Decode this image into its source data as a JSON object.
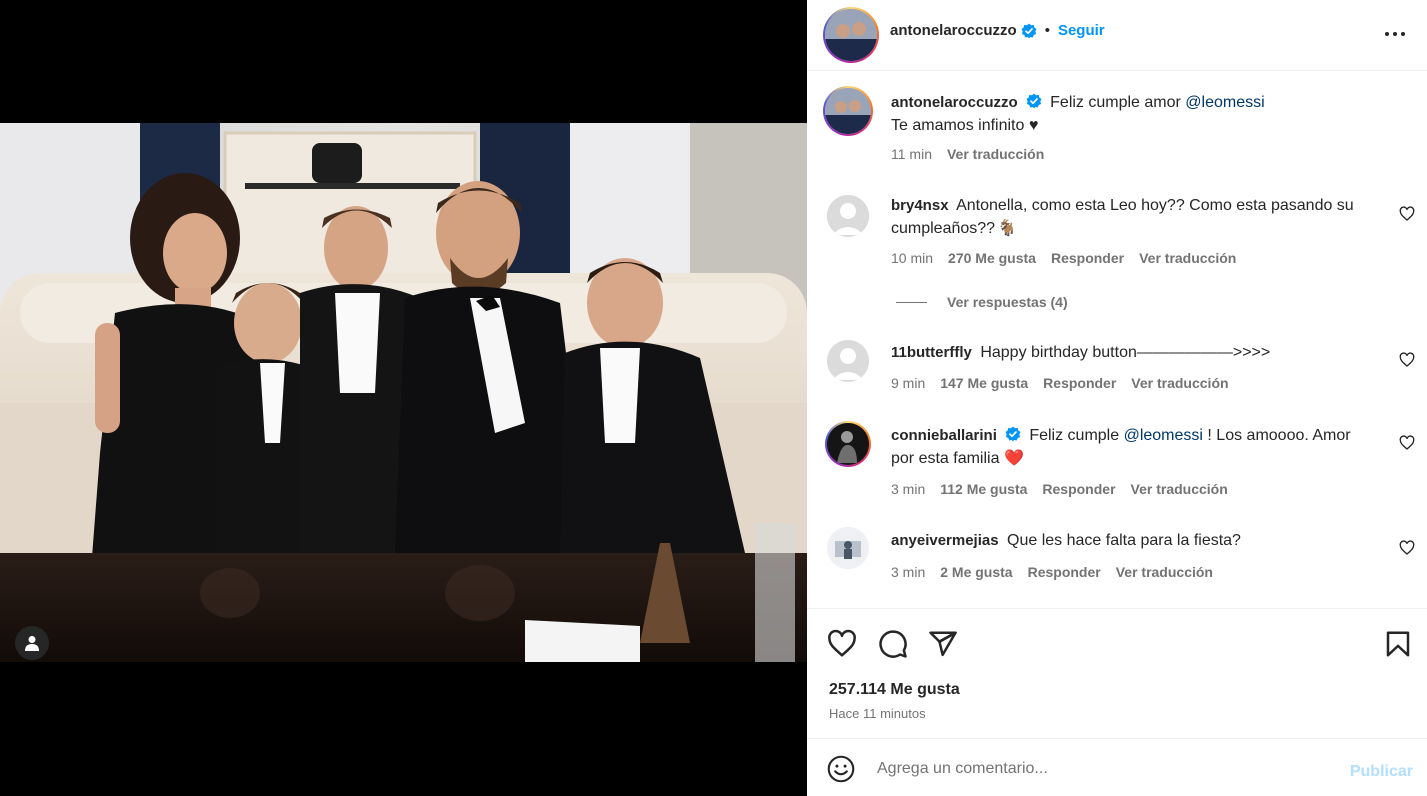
{
  "post": {
    "author": "antonelaroccuzzo",
    "follow_label": "Seguir",
    "separator": "•"
  },
  "caption": {
    "username": "antonelaroccuzzo",
    "text_before": "Feliz cumple amor",
    "mention": "@leomessi",
    "line2": "Te amamos infinito ♥",
    "time": "11 min",
    "translate": "Ver traducción"
  },
  "comments": [
    {
      "username": "bry4nsx",
      "text": "Antonella, como esta Leo hoy?? Como esta pasando su cumpleaños??",
      "emoji": "🐐",
      "time": "10 min",
      "likes": "270 Me gusta",
      "reply": "Responder",
      "translate": "Ver traducción",
      "view_replies": "Ver respuestas (4)"
    },
    {
      "username": "11butterffly",
      "text": "Happy birthday button——————>>>>",
      "time": "9 min",
      "likes": "147 Me gusta",
      "reply": "Responder",
      "translate": "Ver traducción"
    },
    {
      "username": "connieballarini",
      "text_before": "Feliz cumple",
      "mention": "@leomessi",
      "text_after": "! Los amoooo. Amor por esta familia",
      "emoji": "❤️",
      "time": "3 min",
      "likes": "112 Me gusta",
      "reply": "Responder",
      "translate": "Ver traducción"
    },
    {
      "username": "anyeivermejias",
      "text": "Que les hace falta para la fiesta?",
      "time": "3 min",
      "likes": "2 Me gusta",
      "reply": "Responder",
      "translate": "Ver traducción"
    }
  ],
  "stats": {
    "likes": "257.114 Me gusta",
    "time_ago": "Hace 11 minutos"
  },
  "composer": {
    "placeholder": "Agrega un comentario...",
    "publish_label": "Publicar"
  },
  "icons": {
    "more": "more-horizontal-icon",
    "like": "heart-icon",
    "comment": "comment-icon",
    "share": "share-icon",
    "save": "bookmark-icon",
    "emoji": "emoji-icon",
    "tag": "user-tag-icon",
    "verified": "verified-badge-icon"
  },
  "colors": {
    "accent": "#0095f6",
    "publish_disabled": "#b2dffc",
    "mention": "#00376b",
    "muted": "#737373",
    "emoji_heart": "#ed4956"
  }
}
